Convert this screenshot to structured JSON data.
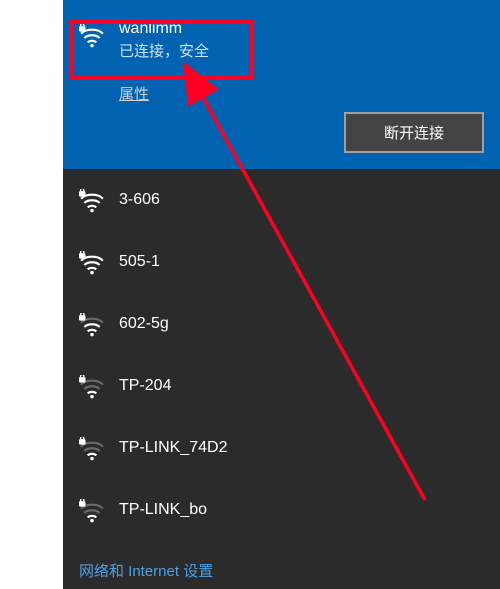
{
  "connected": {
    "ssid": "wanlimm",
    "status": "已连接，安全",
    "properties_label": "属性",
    "disconnect_label": "断开连接"
  },
  "networks": [
    {
      "ssid": "3-606",
      "secured": true,
      "strength": 4
    },
    {
      "ssid": "505-1",
      "secured": true,
      "strength": 4
    },
    {
      "ssid": "602-5g",
      "secured": true,
      "strength": 3
    },
    {
      "ssid": "TP-204",
      "secured": true,
      "strength": 2
    },
    {
      "ssid": "TP-LINK_74D2",
      "secured": true,
      "strength": 2
    },
    {
      "ssid": "TP-LINK_bo",
      "secured": true,
      "strength": 2
    }
  ],
  "footer": {
    "settings_label": "网络和 Internet 设置"
  },
  "annotation": {
    "highlight_color": "#ff0024"
  }
}
